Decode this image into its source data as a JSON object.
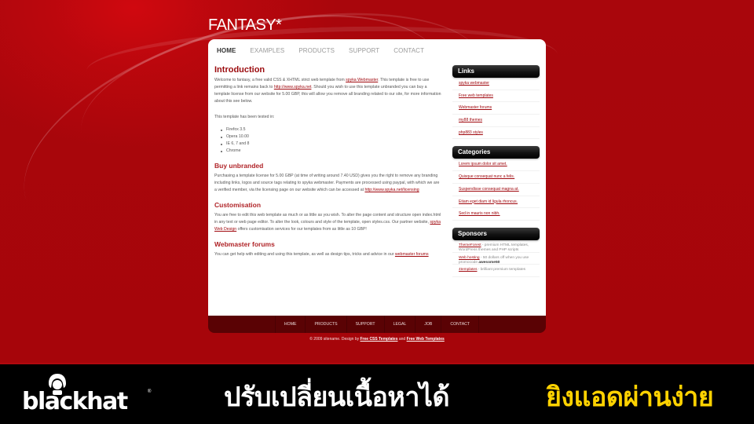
{
  "site": {
    "logo": "FANTASY*",
    "nav": [
      "HOME",
      "EXAMPLES",
      "PRODUCTS",
      "SUPPORT",
      "CONTACT"
    ],
    "active_nav": "HOME"
  },
  "content": {
    "intro": {
      "title": "Introduction",
      "p1_a": "Welcome to fantasy, a free valid CSS & XHTML strict web template from ",
      "p1_link1": "spyka Webmaster",
      "p1_b": ". This template is free to use permitting a link remains back to ",
      "p1_link2": "http://www.spyka.net",
      "p1_c": ". Should you wish to use this template unbranded you can buy a template license from our website for 5.00 GBP, this will allow you remove all branding related to our site, for more information about this see below.",
      "p2": "This template has been tested in:",
      "browsers": [
        "Firefox 3.5",
        "Opera 10.00",
        "IE 6, 7 and 8",
        "Chrome"
      ]
    },
    "unbranded": {
      "title": "Buy unbranded",
      "text": "Purchasing a template license for 5.00 GBP (at time of writing around 7.40 USD) gives you the right to remove any branding including links, logos and source tags relating to spyka webmaster. Payments are processed using paypal, with which we are a verified member, via the licensing page on our website which can be accessed at ",
      "link": "http://www.spyka.net/licensing"
    },
    "custom": {
      "title": "Customisation",
      "text_a": "You are free to edit this web template as much or as little as you wish. To alter the page content and structure open index.html in any text or web page editor. To alter the look, colours and style of the template, open styles.css. Our partner website, ",
      "link": "spyka Web Design",
      "text_b": " offers customisation services for our templates from as little as 10 GBP!"
    },
    "forums": {
      "title": "Webmaster forums",
      "text": "You can get help with editing and using this template, as well as design tips, tricks and advice in our ",
      "link": "webmaster forums"
    }
  },
  "sidebar": {
    "links": {
      "title": "Links",
      "items": [
        "spyka webmaster",
        "Free web templates",
        "Webmaster forums",
        "my88 themes",
        "php883 styles"
      ]
    },
    "categories": {
      "title": "Categories",
      "items": [
        "Lorem ipsum dolor sit amet.",
        "Quisque consequat nunc a felis.",
        "Suspendisse consequat magna at.",
        "Etiam eget diam id ligula rhoncus.",
        "Sed in mauris non nibh."
      ]
    },
    "sponsors": {
      "title": "Sponsors",
      "items": [
        {
          "link": "ThemeForest",
          "text": " - premium HTML templates, WordPress themes and PHP scripts",
          "bold": ""
        },
        {
          "link": "Web hosting",
          "text": " - 50 dollars off when you use promocode ",
          "bold": "awesome50"
        },
        {
          "link": "4templates",
          "text": " - brilliant premium templates",
          "bold": ""
        }
      ]
    }
  },
  "footer": {
    "nav": [
      "HOME",
      "PRODUCTS",
      "SUPPORT",
      "LEGAL",
      "JOB",
      "CONTACT"
    ],
    "copy_a": "© 2009 sitename. Design by ",
    "link1": "Free CSS Templates",
    "copy_b": " and ",
    "link2": "Free Web Templates"
  },
  "banner": {
    "brand": "blackhat",
    "brand_mark": "®",
    "headline": "ปรับเปลี่ยนเนื้อหาได้",
    "tagline": "ยิงแอดผ่านง่าย",
    "tagline_color": "#ffd200"
  }
}
